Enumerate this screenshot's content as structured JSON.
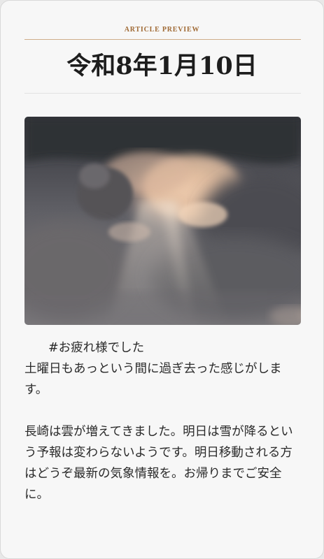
{
  "card": {
    "label": "ARTICLE PREVIEW",
    "title": "令和8年1月10日"
  },
  "image": {
    "subject": "sunlit clouds with crepuscular rays",
    "colors": {
      "sky_dark": "#3c3d43",
      "cloud_mid": "#8b8a8c",
      "glow": "#e9c3a2",
      "highlight": "#f6dcc2"
    }
  },
  "body": {
    "hashtag": "#お疲れ様でした",
    "paragraph1": "土曜日もあっという間に過ぎ去った感じがします。",
    "paragraph2": "長崎は雲が増えてきました。明日は雪が降るという予報は変わらないようです。明日移動される方はどうぞ最新の気象情報を。お帰りまでご安全に。"
  }
}
